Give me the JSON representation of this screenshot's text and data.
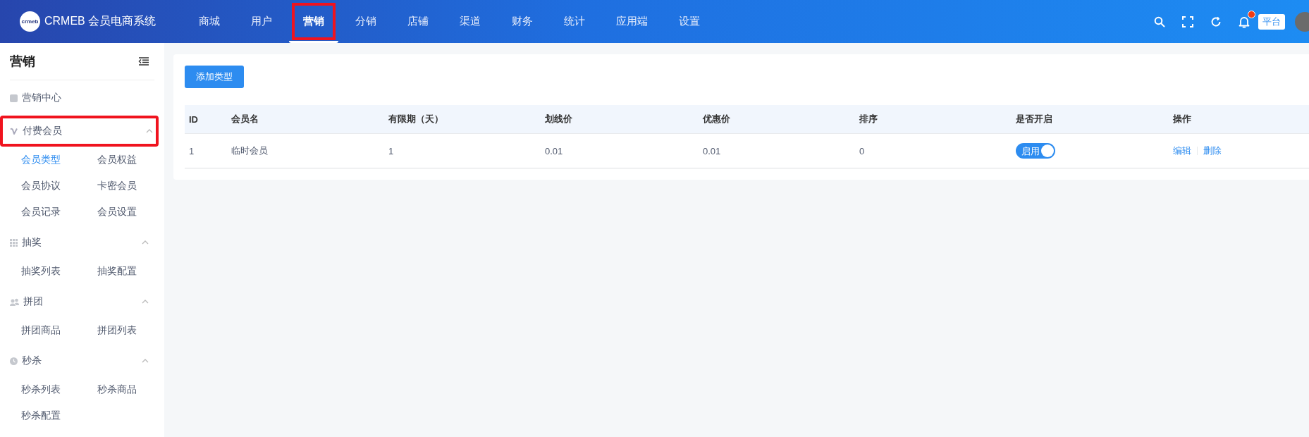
{
  "header": {
    "logo_mark": "crmeb",
    "logo_text": "CRMEB 会员电商系统",
    "nav": [
      {
        "label": "商城",
        "selected": false,
        "highlighted": false
      },
      {
        "label": "用户",
        "selected": false,
        "highlighted": false
      },
      {
        "label": "营销",
        "selected": true,
        "highlighted": true
      },
      {
        "label": "分销",
        "selected": false,
        "highlighted": false
      },
      {
        "label": "店铺",
        "selected": false,
        "highlighted": false
      },
      {
        "label": "渠道",
        "selected": false,
        "highlighted": false
      },
      {
        "label": "财务",
        "selected": false,
        "highlighted": false
      },
      {
        "label": "统计",
        "selected": false,
        "highlighted": false
      },
      {
        "label": "应用端",
        "selected": false,
        "highlighted": false
      },
      {
        "label": "设置",
        "selected": false,
        "highlighted": false
      }
    ],
    "has_notification": true,
    "platform_badge": "平台"
  },
  "sidebar": {
    "title": "营销",
    "groups": [
      {
        "label": "营销中心",
        "highlighted": false
      },
      {
        "label": "付费会员",
        "expanded": true,
        "highlighted": true,
        "children": [
          {
            "label": "会员类型",
            "selected": true
          },
          {
            "label": "会员权益",
            "selected": false
          },
          {
            "label": "会员协议",
            "selected": false
          },
          {
            "label": "卡密会员",
            "selected": false
          },
          {
            "label": "会员记录",
            "selected": false
          },
          {
            "label": "会员设置",
            "selected": false
          }
        ]
      },
      {
        "label": "抽奖",
        "expanded": true,
        "highlighted": false,
        "children": [
          {
            "label": "抽奖列表",
            "selected": false
          },
          {
            "label": "抽奖配置",
            "selected": false
          }
        ]
      },
      {
        "label": "拼团",
        "expanded": true,
        "highlighted": false,
        "children": [
          {
            "label": "拼团商品",
            "selected": false
          },
          {
            "label": "拼团列表",
            "selected": false
          }
        ]
      },
      {
        "label": "秒杀",
        "expanded": true,
        "highlighted": false,
        "children": [
          {
            "label": "秒杀列表",
            "selected": false
          },
          {
            "label": "秒杀商品",
            "selected": false
          },
          {
            "label": "秒杀配置",
            "selected": false
          }
        ]
      }
    ]
  },
  "add_button": "添加类型",
  "table": {
    "columns": [
      "ID",
      "会员名",
      "有限期（天）",
      "划线价",
      "优惠价",
      "排序",
      "是否开启",
      "操作"
    ],
    "rows": [
      {
        "cells": [
          "1",
          "临时会员",
          "1",
          "0.01",
          "0.01",
          "0"
        ],
        "enabled": true,
        "switch_label": "启用",
        "actions": [
          "编辑",
          "删除"
        ]
      }
    ]
  }
}
